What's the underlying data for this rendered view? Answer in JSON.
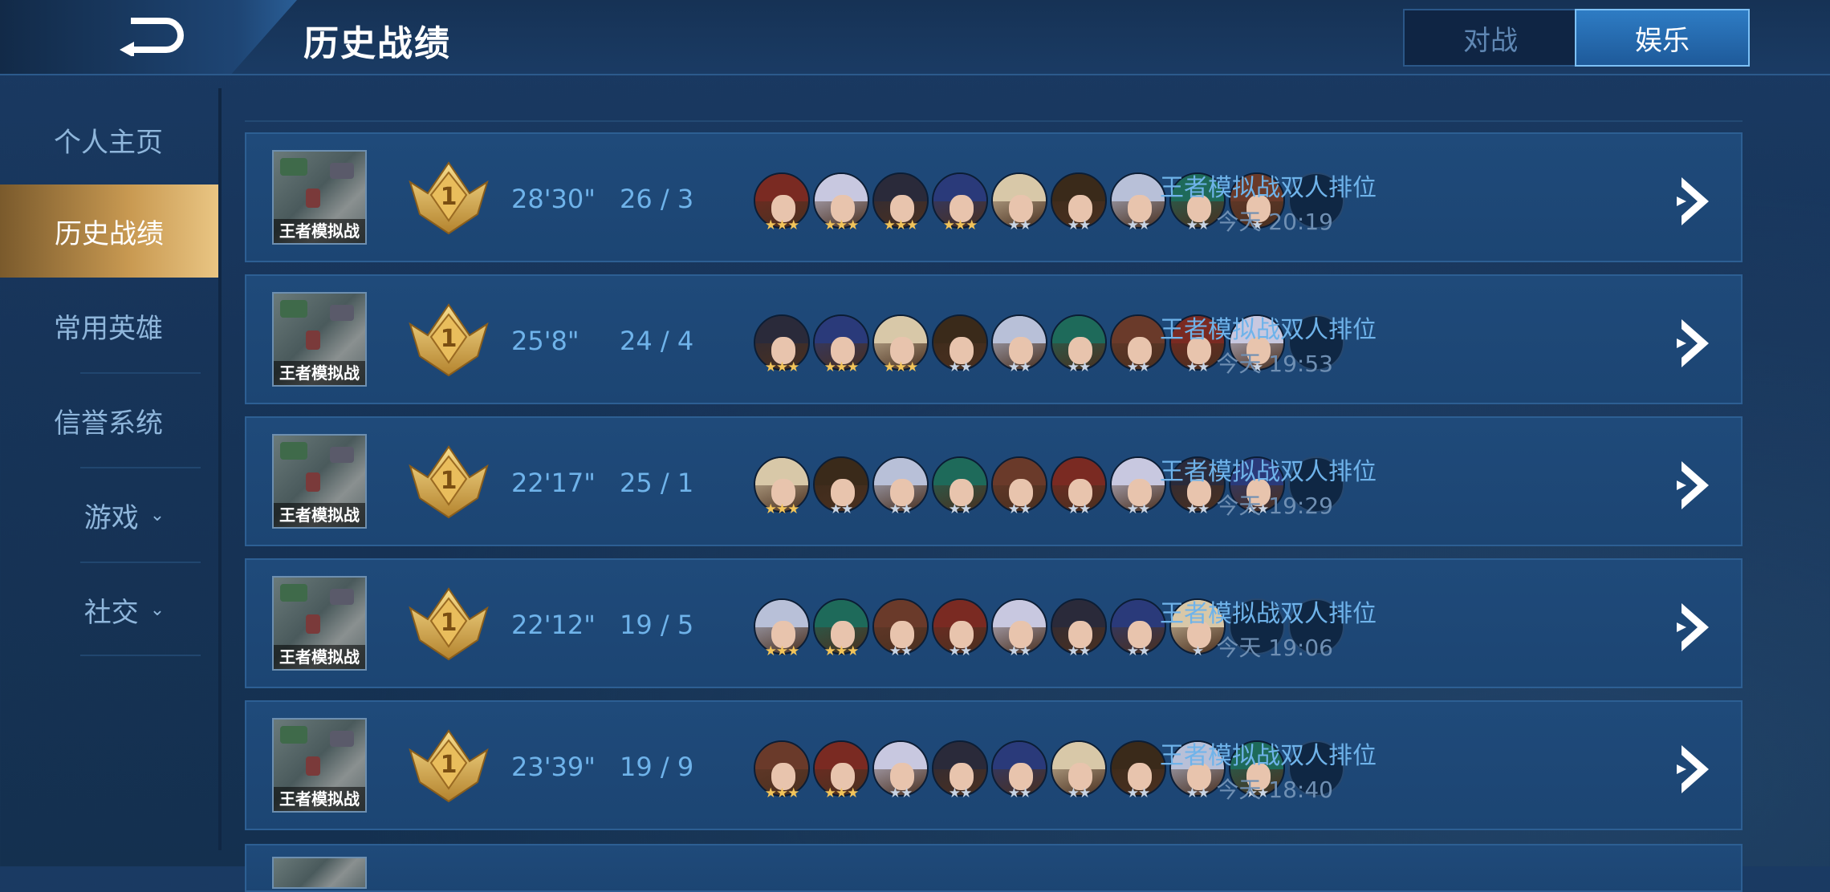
{
  "header": {
    "title": "历史战绩",
    "tabs": [
      {
        "label": "对战",
        "active": false
      },
      {
        "label": "娱乐",
        "active": true
      }
    ]
  },
  "sidebar": {
    "items": [
      {
        "label": "个人主页",
        "active": false,
        "has_arrow": false
      },
      {
        "label": "历史战绩",
        "active": true,
        "has_arrow": false
      },
      {
        "label": "常用英雄",
        "active": false,
        "has_arrow": false
      },
      {
        "label": "信誉系统",
        "active": false,
        "has_arrow": false
      },
      {
        "label": "游戏",
        "active": false,
        "has_arrow": true
      },
      {
        "label": "社交",
        "active": false,
        "has_arrow": true
      }
    ]
  },
  "records": [
    {
      "thumb_label": "王者模拟战",
      "rank": "1",
      "duration": "28'30\"",
      "kd": "26 / 3",
      "heroes": [
        3,
        3,
        3,
        3,
        2,
        2,
        2,
        2,
        1,
        0
      ],
      "mode": "王者模拟战双人排位",
      "time": "今天 20:19"
    },
    {
      "thumb_label": "王者模拟战",
      "rank": "1",
      "duration": "25'8\"",
      "kd": "24 / 4",
      "heroes": [
        3,
        3,
        3,
        2,
        2,
        2,
        2,
        2,
        1,
        0
      ],
      "mode": "王者模拟战双人排位",
      "time": "今天 19:53"
    },
    {
      "thumb_label": "王者模拟战",
      "rank": "1",
      "duration": "22'17\"",
      "kd": "25 / 1",
      "heroes": [
        3,
        2,
        2,
        2,
        2,
        2,
        2,
        2,
        2,
        0
      ],
      "mode": "王者模拟战双人排位",
      "time": "今天 19:29"
    },
    {
      "thumb_label": "王者模拟战",
      "rank": "1",
      "duration": "22'12\"",
      "kd": "19 / 5",
      "heroes": [
        3,
        3,
        2,
        2,
        2,
        2,
        2,
        1,
        0,
        0
      ],
      "mode": "王者模拟战双人排位",
      "time": "今天 19:06"
    },
    {
      "thumb_label": "王者模拟战",
      "rank": "1",
      "duration": "23'39\"",
      "kd": "19 / 9",
      "heroes": [
        3,
        3,
        2,
        2,
        2,
        2,
        2,
        2,
        2,
        0
      ],
      "mode": "王者模拟战双人排位",
      "time": "今天 18:40"
    }
  ],
  "colors": {
    "accent": "#6fb3ea",
    "active_tab": "#2e7cc4",
    "sidebar_active": "#c99a52",
    "star_gold": "#f2c45a"
  }
}
